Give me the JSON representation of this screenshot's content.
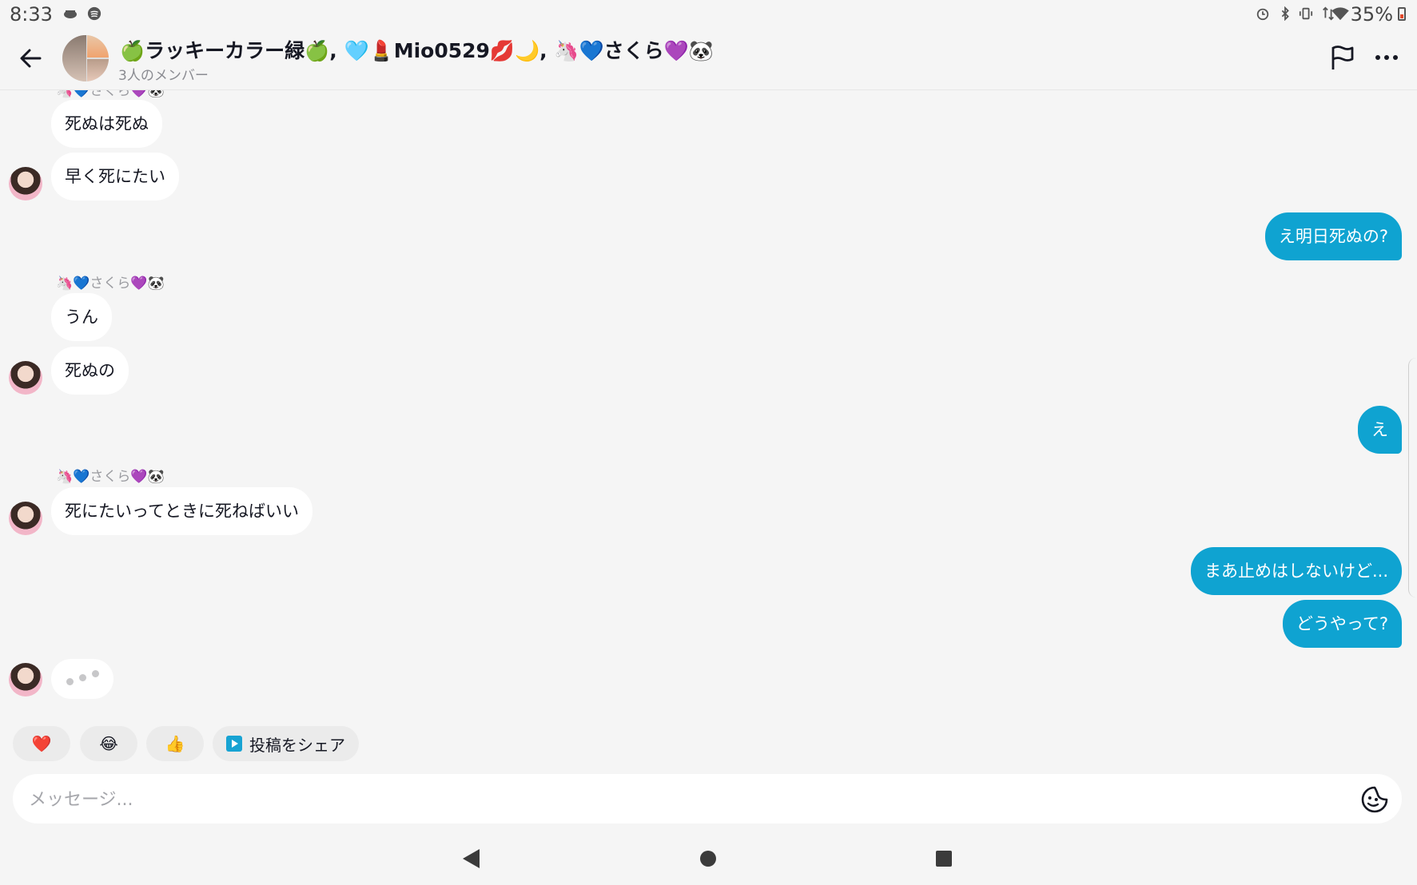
{
  "status_bar": {
    "time": "8:33",
    "left_icons": [
      "cast-icon",
      "spotify-icon"
    ],
    "right_icons": [
      "alarm-icon",
      "bluetooth-icon",
      "vibrate-icon",
      "data-icon",
      "wifi-icon"
    ],
    "battery": "35%"
  },
  "header": {
    "title": "🍏ラッキーカラー緑🍏, 🩵💄Mio0529💋🌙, 🦄💙さくら💜🐼",
    "subtitle": "3人のメンバー"
  },
  "messages": {
    "sender_name": "🦄💙さくら💜🐼",
    "items": [
      {
        "id": "m1",
        "text": "死ぬは死ぬ"
      },
      {
        "id": "m2",
        "text": "早く死にたい"
      },
      {
        "id": "m3",
        "text": "え明日死ぬの?"
      },
      {
        "id": "m4",
        "text": "うん"
      },
      {
        "id": "m5",
        "text": "死ぬの"
      },
      {
        "id": "m6",
        "text": "え"
      },
      {
        "id": "m7",
        "text": "死にたいってときに死ねばいい"
      },
      {
        "id": "m8",
        "text": "まあ止めはしないけど..."
      },
      {
        "id": "m9",
        "text": "どうやって?"
      }
    ]
  },
  "quick_replies": {
    "heart": "❤️",
    "laugh": "😂",
    "thumbs_up": "👍",
    "share_post": "投稿をシェア"
  },
  "composer": {
    "placeholder": "メッセージ..."
  },
  "colors": {
    "outgoing_bubble": "#0fa3d1",
    "incoming_bubble": "#ffffff",
    "background": "#f5f5f5"
  }
}
